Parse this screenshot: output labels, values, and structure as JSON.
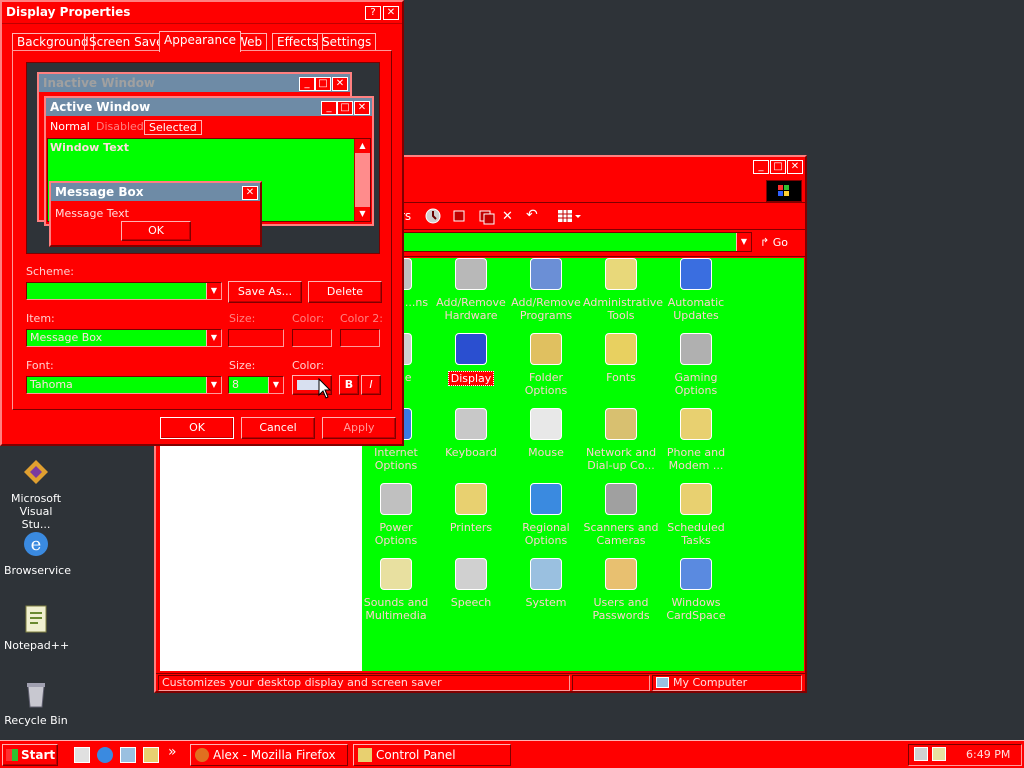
{
  "display_props": {
    "title": "Display Properties",
    "help_btn": "?",
    "close_btn": "✕",
    "tabs": [
      "Background",
      "Screen Saver",
      "Appearance",
      "Web",
      "Effects",
      "Settings"
    ],
    "preview": {
      "inactive_title": "Inactive Window",
      "active_title": "Active Window",
      "menu": [
        "Normal",
        "Disabled",
        "Selected"
      ],
      "window_text": "Window Text",
      "msgbox_title": "Message Box",
      "msgbox_text": "Message Text",
      "msgbox_ok": "OK"
    },
    "scheme_label": "Scheme:",
    "scheme_value": "",
    "save_as": "Save As...",
    "delete": "Delete",
    "item_label": "Item:",
    "item_value": "Message Box",
    "size_label": "Size:",
    "color_label": "Color:",
    "color2_label": "Color 2:",
    "font_label": "Font:",
    "font_value": "Tahoma",
    "font_size_label": "Size:",
    "font_size_value": "8",
    "font_color_label": "Color:",
    "bold": "B",
    "italic": "I",
    "ok": "OK",
    "cancel": "Cancel",
    "apply": "Apply"
  },
  "control_panel": {
    "toolbar_partial": "rs",
    "go": "Go",
    "status_text": "Customizes your desktop display and screen saver",
    "status_zone": "My Computer",
    "icons": [
      {
        "label": "...bility ...ns",
        "color": "#c0c0c0"
      },
      {
        "label": "Add/Remove Hardware",
        "color": "#b8b8b8"
      },
      {
        "label": "Add/Remove Programs",
        "color": "#6b8fd6"
      },
      {
        "label": "Administrative Tools",
        "color": "#e8d87a"
      },
      {
        "label": "Automatic Updates",
        "color": "#3a6ee0"
      },
      {
        "label": "...ime",
        "color": "#d0d0d0"
      },
      {
        "label": "Display",
        "color": "#2a4fd0"
      },
      {
        "label": "Folder Options",
        "color": "#e0c060"
      },
      {
        "label": "Fonts",
        "color": "#e8d060"
      },
      {
        "label": "Gaming Options",
        "color": "#b0b0b0"
      },
      {
        "label": "Internet Options",
        "color": "#3a7ae0"
      },
      {
        "label": "Keyboard",
        "color": "#c8c8c8"
      },
      {
        "label": "Mouse",
        "color": "#e8e8e8"
      },
      {
        "label": "Network and Dial-up Co...",
        "color": "#d8c070"
      },
      {
        "label": "Phone and Modem ...",
        "color": "#e8d070"
      },
      {
        "label": "Power Options",
        "color": "#c0c0c0"
      },
      {
        "label": "Printers",
        "color": "#e8d070"
      },
      {
        "label": "Regional Options",
        "color": "#3a8ae0"
      },
      {
        "label": "Scanners and Cameras",
        "color": "#a0a0a0"
      },
      {
        "label": "Scheduled Tasks",
        "color": "#e8d070"
      },
      {
        "label": "Sounds and Multimedia",
        "color": "#e8e0a0"
      },
      {
        "label": "Speech",
        "color": "#d0d0d0"
      },
      {
        "label": "System",
        "color": "#9ac0e0"
      },
      {
        "label": "Users and Passwords",
        "color": "#e8c070"
      },
      {
        "label": "Windows CardSpace",
        "color": "#5a8ae0"
      }
    ]
  },
  "desktop": [
    {
      "label": "Microsoft Visual Stu...",
      "color": "#e0a030"
    },
    {
      "label": "Browservice",
      "color": "#3a8ae0"
    },
    {
      "label": "Notepad++",
      "color": "#d8e8a0"
    },
    {
      "label": "Recycle Bin",
      "color": "#c8c8d0"
    }
  ],
  "taskbar": {
    "start": "Start",
    "quicklaunch_more": "»",
    "items": [
      "Alex - Mozilla Firefox",
      "Control Panel"
    ],
    "clock": "6:49 PM"
  },
  "colors": {
    "accent": "#ff0000",
    "window_bg": "#00ff00",
    "titlebar": "#6e8ba6",
    "desktop": "#2e3338"
  }
}
